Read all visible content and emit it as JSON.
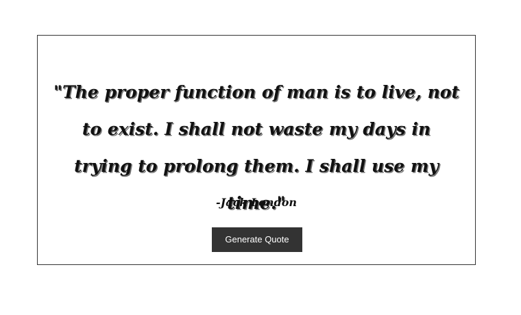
{
  "quote": {
    "text": "\"The proper function of man is to live, not to exist. I shall not waste my days in trying to prolong them. I shall use my time.\"",
    "author": "-Jack London"
  },
  "button": {
    "label": "Generate Quote"
  },
  "colors": {
    "background": "#ffffff",
    "border": "#333333",
    "text": "#111111",
    "button_bg": "#333333",
    "button_text": "#ffffff"
  }
}
